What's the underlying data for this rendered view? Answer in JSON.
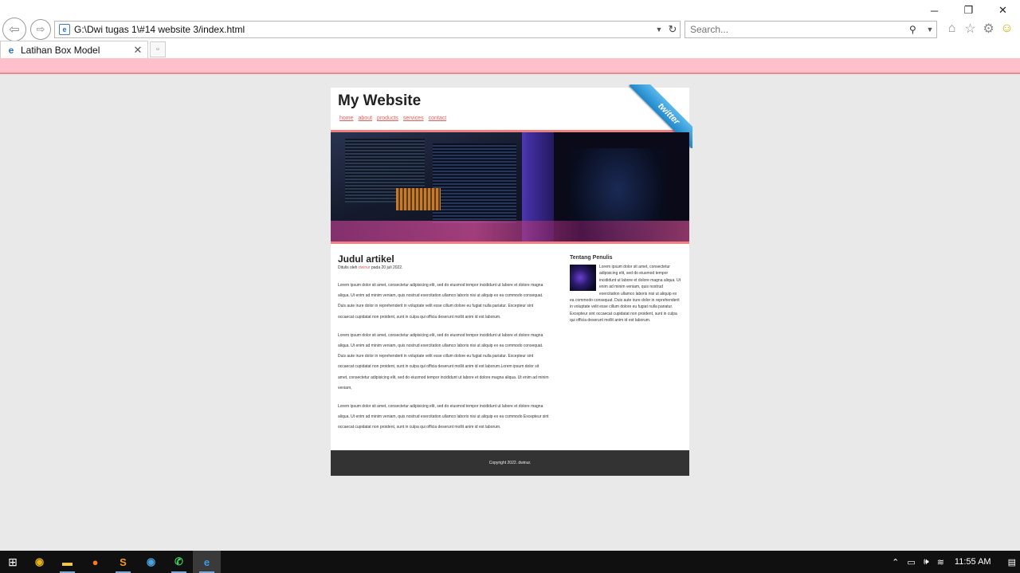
{
  "browser": {
    "address_url": "G:\\Dwi tugas 1\\#14 website 3/index.html",
    "search_placeholder": "Search...",
    "tab_title": "Latihan Box Model",
    "window_controls": {
      "minimize": "─",
      "restore": "❐",
      "close": "✕"
    }
  },
  "site": {
    "title": "My Website",
    "nav": [
      "home",
      "about",
      "products",
      "services",
      "contact"
    ],
    "ribbon_label": "twitter",
    "article": {
      "title": "Judul artikel",
      "meta_prefix": "Ditulis oleh ",
      "author": "dwinur",
      "meta_suffix": " pada 20 juli 2022.",
      "paragraphs": [
        "Lorem ipsum dolor sit amet, consectetur adipisicing elit, sed do eiusmod tempor incididunt ut labore et dolore magna aliqua. Ut enim ad minim veniam, quis nostrud exercitation ullamco laboris nisi ut aliquip ex ea commodo consequat. Duis aute irure dolor in reprehenderit in voluptate velit esse cillum dolore eu fugiat nulla pariatur. Excepteur sint occaecat cupidatat non proident, sunt in culpa qui officia deserunt mollit anim id est laborum.",
        "Lorem ipsum dolor sit amet, consectetur adipisicing elit, sed do eiusmod tempor incididunt ut labore et dolore magna aliqua. Ut enim ad minim veniam, quis nostrud exercitation ullamco laboris nisi ut aliquip ex ea commodo consequat. Duis aute irure dolor in reprehenderit in voluptate velit esse cillum dolore eu fugiat nulla pariatur. Excepteur sint occaecat cupidatat non proident, sunt in culpa qui officia deserunt mollit anim id est laborum.Lorem ipsum dolor sit amet, consectetur adipisicing elit, sed do eiusmod tempor incididunt ut labore et dolore magna aliqua. Ut enim ad minim veniam,",
        "Lorem ipsum dolor sit amet, consectetur adipisicing elit, sed do eiusmod tempor incididunt ut labore et dolore magna aliqua. Ut enim ad minim veniam, quis nostrud exercitation ullamco laboris nisi ut aliquip ex ea commodo Excepteur sint occaecat cupidatat non proident, sunt in culpa qui officia deserunt mollit anim id est laborum."
      ]
    },
    "sidebar": {
      "title": "Tentang Penulis",
      "body": "Lorem ipsum dolor sit amet, consectetur adipisicing elit, sed do eiusmod tempor incididunt ut labore et dolore magna aliqua. Ut enim ad minim veniam, quis nostrud exercitation ullamco laboris nisi ut aliquip ex ea commodo consequat. Duis aute irure dolor in reprehenderit in voluptate velit esse cillum dolore eu fugiat nulla pariatur. Excepteur sint occaecat cupidatat non proident, sunt in culpa qui officia deserunt mollit anim id est laborum."
    },
    "footer": "Copyright 2022. dwinur."
  },
  "taskbar": {
    "apps": [
      {
        "name": "chrome-icon",
        "glyph": "◉",
        "color": "#e8b21a"
      },
      {
        "name": "file-explorer-icon",
        "glyph": "▬",
        "color": "#f2c84b"
      },
      {
        "name": "firefox-icon",
        "glyph": "●",
        "color": "#ff7a1a"
      },
      {
        "name": "sublime-text-icon",
        "glyph": "S",
        "color": "#f59a23"
      },
      {
        "name": "chrome-alt-icon",
        "glyph": "◉",
        "color": "#4aa3df"
      },
      {
        "name": "whatsapp-icon",
        "glyph": "✆",
        "color": "#3ecf5c"
      },
      {
        "name": "internet-explorer-icon",
        "glyph": "e",
        "color": "#3a9be8"
      }
    ],
    "clock": "11:55 AM"
  }
}
